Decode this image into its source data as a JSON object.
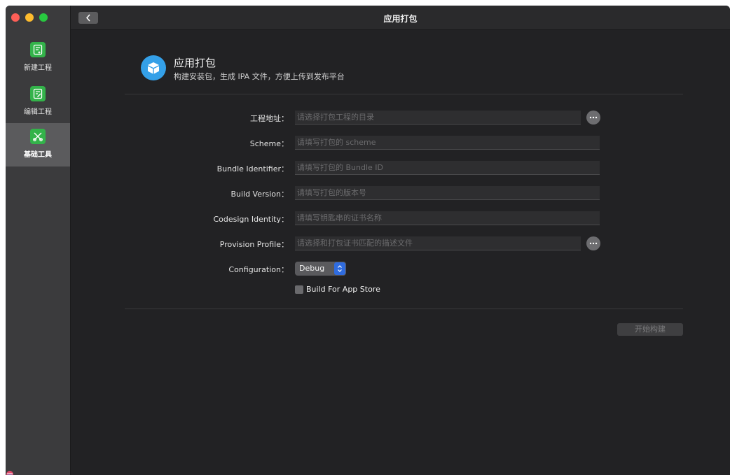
{
  "window": {
    "title": "应用打包"
  },
  "sidebar": {
    "items": [
      {
        "label": "新建工程",
        "icon": "new-project-icon"
      },
      {
        "label": "编辑工程",
        "icon": "edit-project-icon"
      },
      {
        "label": "基础工具",
        "icon": "tools-icon",
        "active": true
      }
    ]
  },
  "header": {
    "title": "应用打包",
    "subtitle": "构建安装包，生成 IPA 文件，方便上传到发布平台",
    "icon": "package-box-icon"
  },
  "form": {
    "project_path": {
      "label": "工程地址：",
      "placeholder": "请选择打包工程的目录"
    },
    "scheme": {
      "label": "Scheme：",
      "placeholder": "请填写打包的 scheme"
    },
    "bundle_id": {
      "label": "Bundle Identifier：",
      "placeholder": "请填写打包的 Bundle ID"
    },
    "build_version": {
      "label": "Build Version：",
      "placeholder": "请填写打包的版本号"
    },
    "codesign_identity": {
      "label": "Codesign Identity：",
      "placeholder": "请填写钥匙串的证书名称"
    },
    "provision_profile": {
      "label": "Provision Profile：",
      "placeholder": "请选择和打包证书匹配的描述文件"
    },
    "configuration": {
      "label": "Configuration：",
      "value": "Debug"
    },
    "app_store": {
      "label": "Build For App Store",
      "checked": false
    }
  },
  "actions": {
    "start_build": "开始构建"
  },
  "colors": {
    "accent": "#2f6ce0",
    "sidebar_icon": "#33b34a",
    "header_icon": "#34a0e8"
  }
}
